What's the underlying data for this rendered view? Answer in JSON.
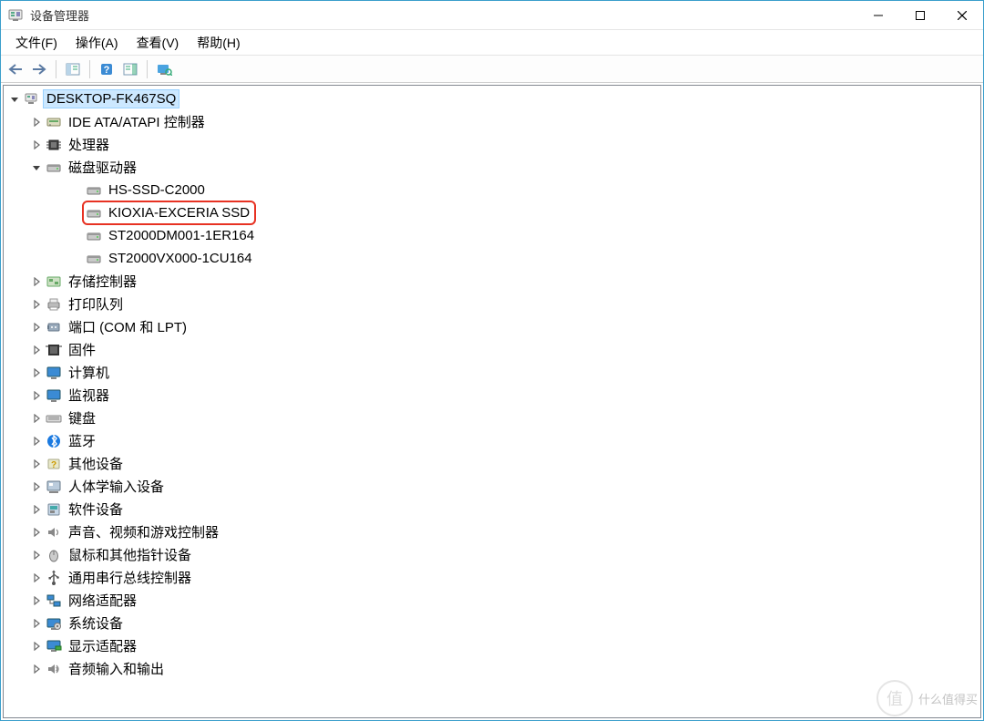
{
  "window": {
    "title": "设备管理器"
  },
  "menu": {
    "file": "文件(F)",
    "action": "操作(A)",
    "view": "查看(V)",
    "help": "帮助(H)"
  },
  "toolbar": {
    "back": "back",
    "forward": "forward",
    "properties": "properties",
    "help": "help",
    "refresh": "refresh",
    "monitor": "monitor"
  },
  "tree": {
    "root": {
      "label": "DESKTOP-FK467SQ",
      "expanded": true,
      "selected": true,
      "icon": "computer"
    },
    "items": [
      {
        "label": "IDE ATA/ATAPI 控制器",
        "expanded": false,
        "icon": "ide",
        "children": []
      },
      {
        "label": "处理器",
        "expanded": false,
        "icon": "cpu",
        "children": []
      },
      {
        "label": "磁盘驱动器",
        "expanded": true,
        "icon": "disk",
        "children": [
          {
            "label": "HS-SSD-C2000",
            "icon": "disk"
          },
          {
            "label": "KIOXIA-EXCERIA SSD",
            "icon": "disk",
            "highlighted": true
          },
          {
            "label": "ST2000DM001-1ER164",
            "icon": "disk"
          },
          {
            "label": "ST2000VX000-1CU164",
            "icon": "disk"
          }
        ]
      },
      {
        "label": "存储控制器",
        "expanded": false,
        "icon": "storage-ctrl",
        "children": []
      },
      {
        "label": "打印队列",
        "expanded": false,
        "icon": "printer",
        "children": []
      },
      {
        "label": "端口 (COM 和 LPT)",
        "expanded": false,
        "icon": "port",
        "children": []
      },
      {
        "label": "固件",
        "expanded": false,
        "icon": "firmware",
        "children": []
      },
      {
        "label": "计算机",
        "expanded": false,
        "icon": "monitor",
        "children": []
      },
      {
        "label": "监视器",
        "expanded": false,
        "icon": "monitor",
        "children": []
      },
      {
        "label": "键盘",
        "expanded": false,
        "icon": "keyboard",
        "children": []
      },
      {
        "label": "蓝牙",
        "expanded": false,
        "icon": "bluetooth",
        "children": []
      },
      {
        "label": "其他设备",
        "expanded": false,
        "icon": "unknown",
        "children": []
      },
      {
        "label": "人体学输入设备",
        "expanded": false,
        "icon": "hid",
        "children": []
      },
      {
        "label": "软件设备",
        "expanded": false,
        "icon": "software",
        "children": []
      },
      {
        "label": "声音、视频和游戏控制器",
        "expanded": false,
        "icon": "sound",
        "children": []
      },
      {
        "label": "鼠标和其他指针设备",
        "expanded": false,
        "icon": "mouse",
        "children": []
      },
      {
        "label": "通用串行总线控制器",
        "expanded": false,
        "icon": "usb",
        "children": []
      },
      {
        "label": "网络适配器",
        "expanded": false,
        "icon": "network",
        "children": []
      },
      {
        "label": "系统设备",
        "expanded": false,
        "icon": "system",
        "children": []
      },
      {
        "label": "显示适配器",
        "expanded": false,
        "icon": "display",
        "children": []
      },
      {
        "label": "音频输入和输出",
        "expanded": false,
        "icon": "audio",
        "children": []
      }
    ]
  },
  "watermark": {
    "text": "什么值得买",
    "badge": "值"
  }
}
